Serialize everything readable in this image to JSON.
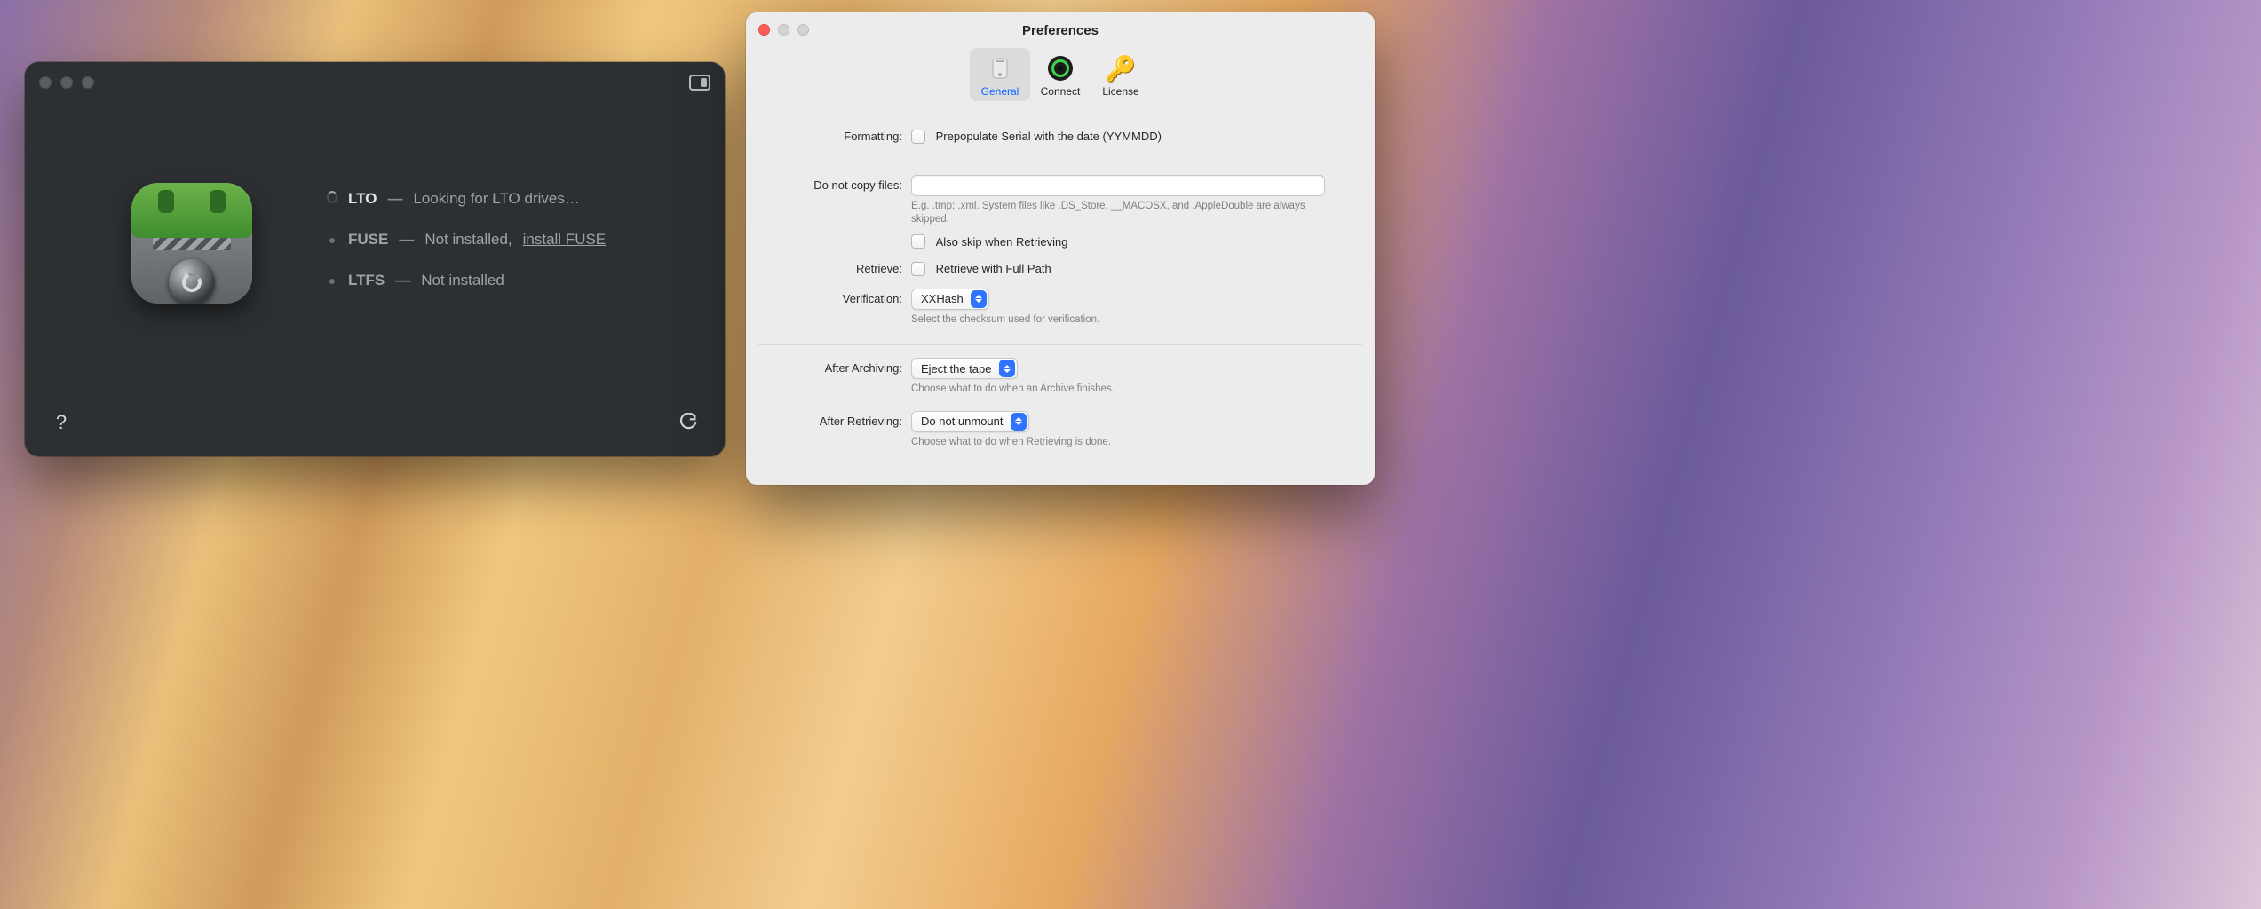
{
  "main": {
    "status": [
      {
        "name": "LTO",
        "msg": "Looking for LTO drives…",
        "kind": "spinner"
      },
      {
        "name": "FUSE",
        "msg": "Not installed,",
        "link": "install FUSE",
        "kind": "dot"
      },
      {
        "name": "LTFS",
        "msg": "Not installed",
        "kind": "dot"
      }
    ]
  },
  "prefs": {
    "title": "Preferences",
    "tabs": {
      "general": "General",
      "connect": "Connect",
      "license": "License"
    },
    "labels": {
      "formatting": "Formatting:",
      "do_not_copy": "Do not copy files:",
      "retrieve": "Retrieve:",
      "verification": "Verification:",
      "after_archiving": "After Archiving:",
      "after_retrieving": "After Retrieving:"
    },
    "checks": {
      "prepopulate": "Prepopulate Serial with the date (YYMMDD)",
      "also_skip": "Also skip when Retrieving",
      "full_path": "Retrieve with Full Path"
    },
    "hints": {
      "exclude": "E.g. .tmp; .xml. System files like .DS_Store, __MACOSX, and .AppleDouble are always skipped.",
      "verify": "Select the checksum used for verification.",
      "after_arch": "Choose what to do when an Archive finishes.",
      "after_ret": "Choose what to do when Retrieving is done."
    },
    "selects": {
      "verification": "XXHash",
      "after_archiving": "Eject the tape",
      "after_retrieving": "Do not unmount"
    },
    "exclude_value": ""
  }
}
